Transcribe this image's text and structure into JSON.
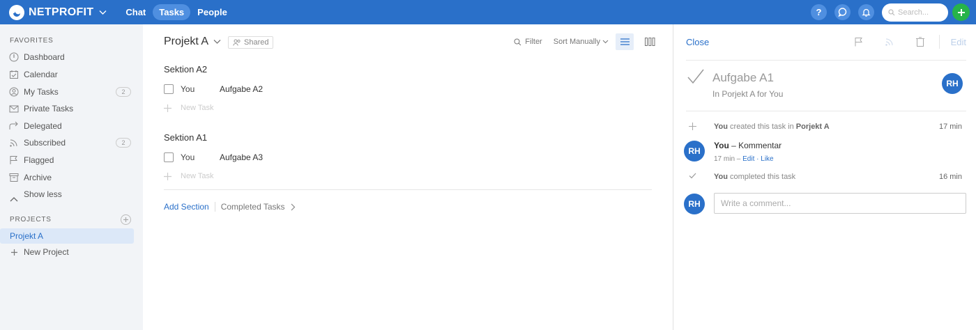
{
  "header": {
    "logo_text": "NETPROFIT",
    "tabs": [
      {
        "label": "Chat",
        "active": false
      },
      {
        "label": "Tasks",
        "active": true
      },
      {
        "label": "People",
        "active": false
      }
    ],
    "help_label": "?",
    "search_placeholder": "Search..."
  },
  "sidebar": {
    "favorites_heading": "FAVORITES",
    "items": [
      {
        "label": "Dashboard",
        "icon": "dashboard-icon"
      },
      {
        "label": "Calendar",
        "icon": "calendar-icon"
      },
      {
        "label": "My Tasks",
        "icon": "user-icon",
        "count": "2"
      },
      {
        "label": "Private Tasks",
        "icon": "envelope-icon"
      },
      {
        "label": "Delegated",
        "icon": "delegate-icon"
      },
      {
        "label": "Subscribed",
        "icon": "rss-icon",
        "count": "2"
      },
      {
        "label": "Flagged",
        "icon": "flag-icon"
      },
      {
        "label": "Archive",
        "icon": "archive-icon"
      }
    ],
    "show_less": "Show less",
    "projects_heading": "PROJECTS",
    "projects": [
      {
        "label": "Projekt A",
        "active": true
      }
    ],
    "new_project": "New Project"
  },
  "main": {
    "project_title": "Projekt A",
    "shared_label": "Shared",
    "filter_label": "Filter",
    "sort_label": "Sort Manually",
    "sections": [
      {
        "title": "Sektion A2",
        "tasks": [
          {
            "assignee": "You",
            "name": "Aufgabe A2"
          }
        ],
        "new_task": "New Task"
      },
      {
        "title": "Sektion A1",
        "tasks": [
          {
            "assignee": "You",
            "name": "Aufgabe A3"
          }
        ],
        "new_task": "New Task"
      }
    ],
    "add_section": "Add Section",
    "completed_tasks": "Completed Tasks"
  },
  "detail": {
    "close_label": "Close",
    "edit_label": "Edit",
    "task_title": "Aufgabe A1",
    "task_subtitle": "In Porjekt A for You",
    "assignee_initials": "RH",
    "activity": [
      {
        "actor": "You",
        "text": " created this task in ",
        "target": "Porjekt A",
        "time": "17 min"
      }
    ],
    "comment": {
      "initials": "RH",
      "author": "You",
      "text": " – Kommentar",
      "meta_time": "17 min – ",
      "edit": "Edit",
      "sep": " · ",
      "like": "Like"
    },
    "completed": {
      "actor": "You",
      "text": " completed this task",
      "time": "16 min"
    },
    "composer": {
      "initials": "RH",
      "placeholder": "Write a comment..."
    }
  },
  "colors": {
    "brand": "#2a70c9",
    "add": "#27b34a",
    "sidebar_bg": "#f2f4f7"
  }
}
